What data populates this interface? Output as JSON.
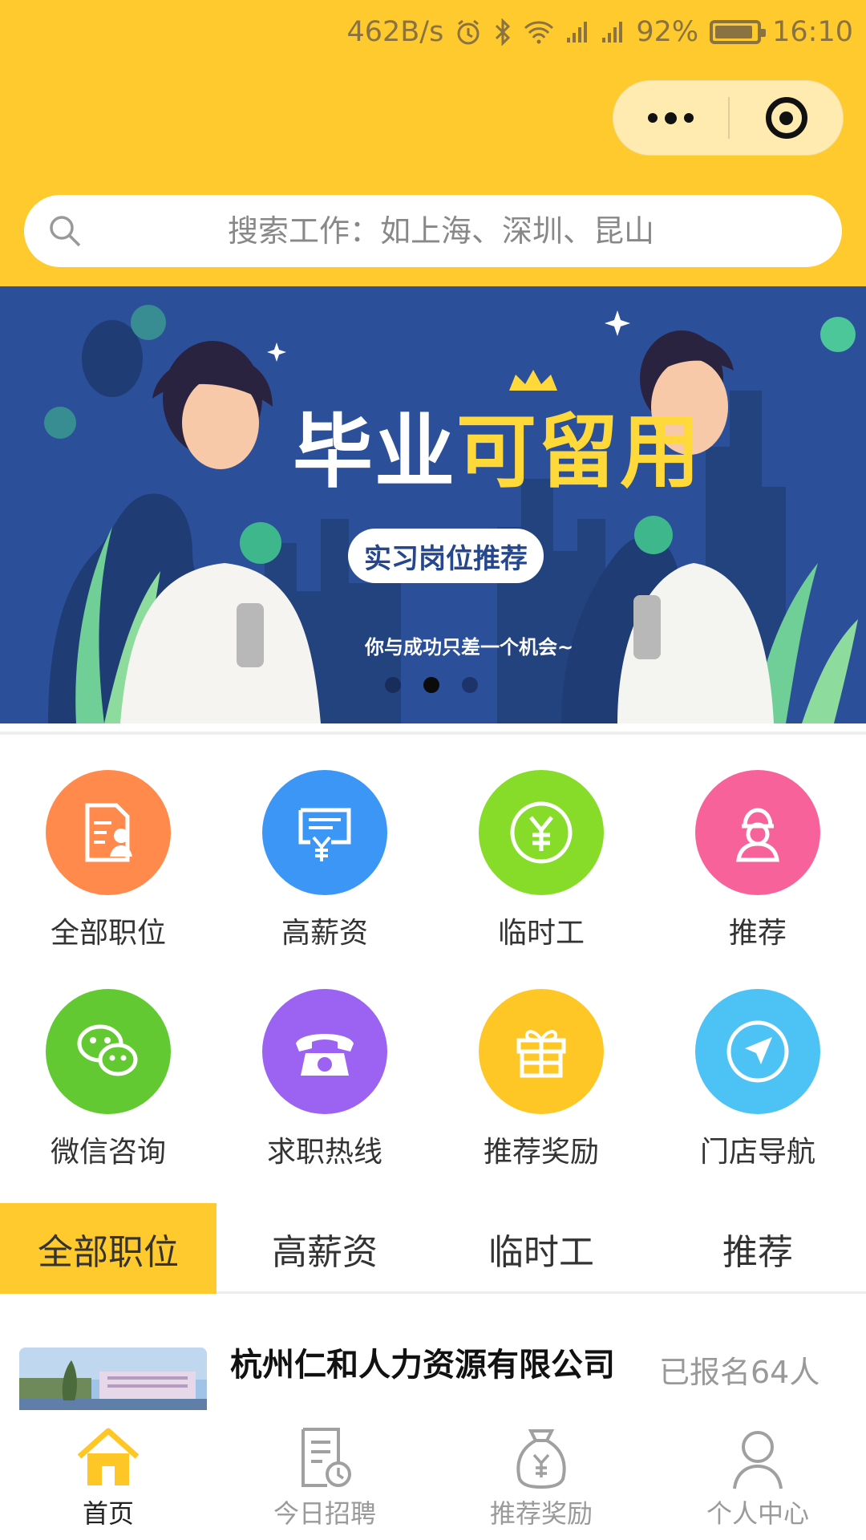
{
  "status_bar": {
    "net_speed": "462B/s",
    "battery_percent": "92%",
    "battery_level": 0.92,
    "time": "16:10"
  },
  "search": {
    "placeholder": "搜索工作：如上海、深圳、昆山"
  },
  "banner": {
    "headline_white": "毕业",
    "headline_yellow": "可留用",
    "pill_text": "实习岗位推荐",
    "slogan": "你与成功只差一个机会~",
    "slide_count": 3,
    "active_slide": 2
  },
  "grid": {
    "items": [
      {
        "label": "全部职位",
        "icon": "document-user-icon",
        "color": "#FF8A4C"
      },
      {
        "label": "高薪资",
        "icon": "yen-receipt-icon",
        "color": "#3C96F5"
      },
      {
        "label": "临时工",
        "icon": "yen-coin-icon",
        "color": "#86DC28"
      },
      {
        "label": "推荐",
        "icon": "worker-icon",
        "color": "#F7629B"
      },
      {
        "label": "微信咨询",
        "icon": "wechat-icon",
        "color": "#63C932"
      },
      {
        "label": "求职热线",
        "icon": "telephone-icon",
        "color": "#9C63F2"
      },
      {
        "label": "推荐奖励",
        "icon": "gift-icon",
        "color": "#FFC726"
      },
      {
        "label": "门店导航",
        "icon": "compass-icon",
        "color": "#4CC2F5"
      }
    ]
  },
  "tabs": [
    {
      "label": "全部职位",
      "active": true
    },
    {
      "label": "高薪资",
      "active": false
    },
    {
      "label": "临时工",
      "active": false
    },
    {
      "label": "推荐",
      "active": false
    }
  ],
  "job_list": [
    {
      "company": "杭州仁和人力资源有限公司",
      "signed_up": "已报名64人"
    }
  ],
  "bottom_nav": [
    {
      "label": "首页",
      "icon": "home-icon",
      "active": true
    },
    {
      "label": "今日招聘",
      "icon": "document-clock-icon",
      "active": false
    },
    {
      "label": "推荐奖励",
      "icon": "money-bag-icon",
      "active": false
    },
    {
      "label": "个人中心",
      "icon": "person-icon",
      "active": false
    }
  ],
  "colors": {
    "brand_yellow": "#FFCA2E",
    "banner_blue": "#2C4F99"
  }
}
